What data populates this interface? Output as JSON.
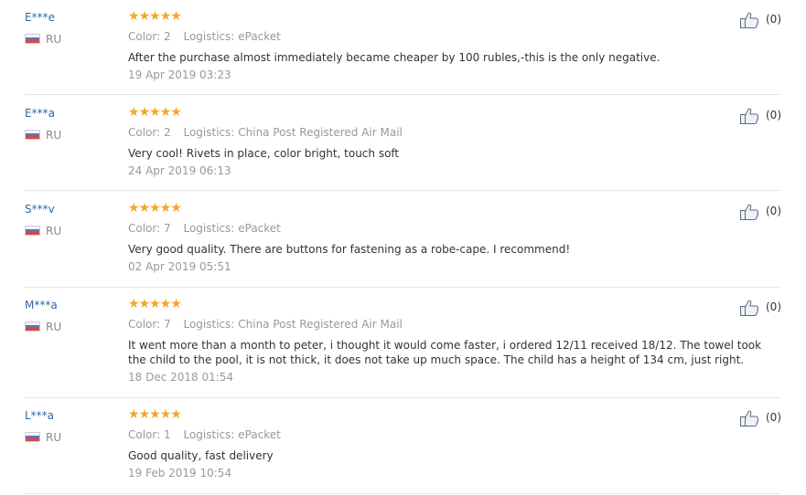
{
  "reviews": [
    {
      "user": "E***e",
      "country": "RU",
      "color_label": "Color:",
      "color_value": "2",
      "logistics_label": "Logistics:",
      "logistics_value": "ePacket",
      "text": "After the purchase almost immediately became cheaper by 100 rubles,-this is the only negative.",
      "date": "19 Apr 2019 03:23",
      "likes": "(0)",
      "rating": 5
    },
    {
      "user": "E***a",
      "country": "RU",
      "color_label": "Color:",
      "color_value": "2",
      "logistics_label": "Logistics:",
      "logistics_value": "China Post Registered Air Mail",
      "text": "Very cool! Rivets in place, color bright, touch soft",
      "date": "24 Apr 2019 06:13",
      "likes": "(0)",
      "rating": 5
    },
    {
      "user": "S***v",
      "country": "RU",
      "color_label": "Color:",
      "color_value": "7",
      "logistics_label": "Logistics:",
      "logistics_value": "ePacket",
      "text": "Very good quality. There are buttons for fastening as a robe-cape. I recommend!",
      "date": "02 Apr 2019 05:51",
      "likes": "(0)",
      "rating": 5
    },
    {
      "user": "M***a",
      "country": "RU",
      "color_label": "Color:",
      "color_value": "7",
      "logistics_label": "Logistics:",
      "logistics_value": "China Post Registered Air Mail",
      "text": "It went more than a month to peter, i thought it would come faster, i ordered 12/11 received 18/12. The towel took the child to the pool, it is not thick, it does not take up much space. The child has a height of 134 cm, just right.",
      "date": "18 Dec 2018 01:54",
      "likes": "(0)",
      "rating": 5
    },
    {
      "user": "L***a",
      "country": "RU",
      "color_label": "Color:",
      "color_value": "1",
      "logistics_label": "Logistics:",
      "logistics_value": "ePacket",
      "text": "Good quality, fast delivery",
      "date": "19 Feb 2019 10:54",
      "likes": "(0)",
      "rating": 5
    }
  ],
  "icons": {
    "rating": "star-icon",
    "like": "thumbs-up-icon",
    "flag": "russia-flag-icon"
  },
  "colors": {
    "star": "#f5a623",
    "username": "#3366aa",
    "muted": "#999999",
    "text": "#333333"
  }
}
